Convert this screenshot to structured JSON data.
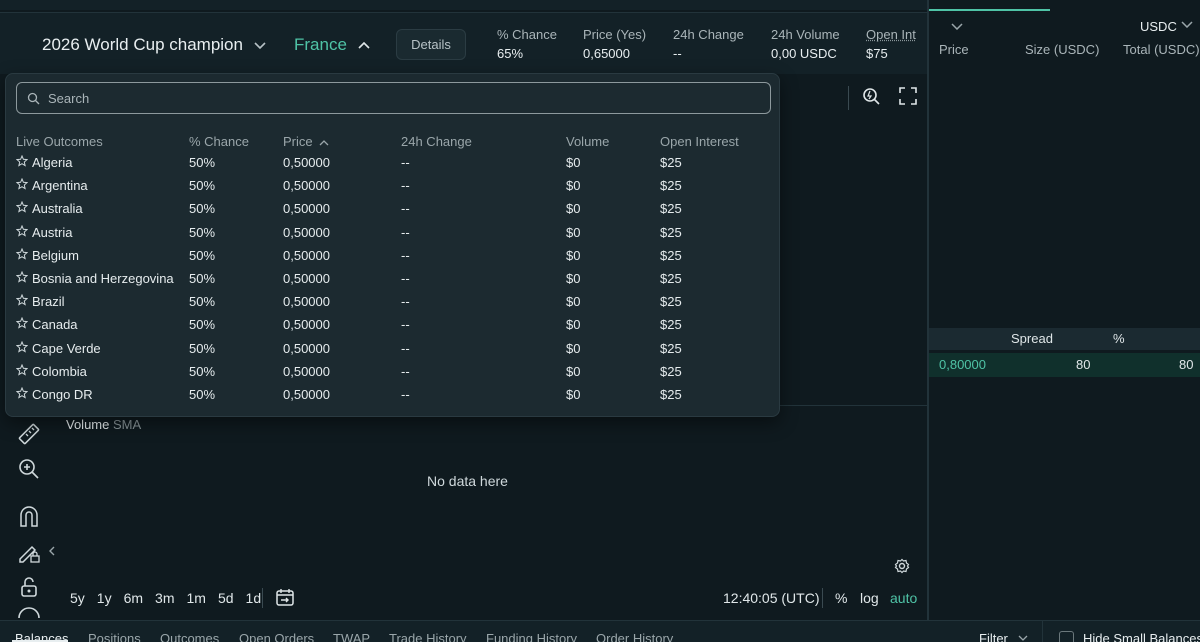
{
  "header": {
    "market_title": "2026 World Cup champion",
    "selected_outcome": "France",
    "details_label": "Details",
    "stats": [
      {
        "label": "% Chance",
        "value": "65%"
      },
      {
        "label": "Price (Yes)",
        "value": "0,65000"
      },
      {
        "label": "24h Change",
        "value": "--"
      },
      {
        "label": "24h Volume",
        "value": "0,00 USDC"
      },
      {
        "label": "Open Interest",
        "value": "$75"
      }
    ]
  },
  "orderbook": {
    "currency": "USDC",
    "columns": [
      "Price",
      "Size (USDC)",
      "Total (USDC)"
    ],
    "spread_label": "Spread",
    "spread_pct_label": "%",
    "ask_row": {
      "price": "0,80000",
      "size": "80",
      "total": "80"
    }
  },
  "dropdown": {
    "search_placeholder": "Search",
    "columns": [
      "Live Outcomes",
      "% Chance",
      "Price",
      "24h Change",
      "Volume",
      "Open Interest"
    ],
    "rows": [
      {
        "name": "Algeria",
        "chance": "50%",
        "price": "0,50000",
        "change": "--",
        "volume": "$0",
        "oi": "$25"
      },
      {
        "name": "Argentina",
        "chance": "50%",
        "price": "0,50000",
        "change": "--",
        "volume": "$0",
        "oi": "$25"
      },
      {
        "name": "Australia",
        "chance": "50%",
        "price": "0,50000",
        "change": "--",
        "volume": "$0",
        "oi": "$25"
      },
      {
        "name": "Austria",
        "chance": "50%",
        "price": "0,50000",
        "change": "--",
        "volume": "$0",
        "oi": "$25"
      },
      {
        "name": "Belgium",
        "chance": "50%",
        "price": "0,50000",
        "change": "--",
        "volume": "$0",
        "oi": "$25"
      },
      {
        "name": "Bosnia and Herzegovina",
        "chance": "50%",
        "price": "0,50000",
        "change": "--",
        "volume": "$0",
        "oi": "$25"
      },
      {
        "name": "Brazil",
        "chance": "50%",
        "price": "0,50000",
        "change": "--",
        "volume": "$0",
        "oi": "$25"
      },
      {
        "name": "Canada",
        "chance": "50%",
        "price": "0,50000",
        "change": "--",
        "volume": "$0",
        "oi": "$25"
      },
      {
        "name": "Cape Verde",
        "chance": "50%",
        "price": "0,50000",
        "change": "--",
        "volume": "$0",
        "oi": "$25"
      },
      {
        "name": "Colombia",
        "chance": "50%",
        "price": "0,50000",
        "change": "--",
        "volume": "$0",
        "oi": "$25"
      },
      {
        "name": "Congo DR",
        "chance": "50%",
        "price": "0,50000",
        "change": "--",
        "volume": "$0",
        "oi": "$25"
      }
    ]
  },
  "chart": {
    "volume_label": "Volume",
    "volume_indicator": "SMA",
    "empty_text": "No data here",
    "timeframes": [
      "5y",
      "1y",
      "6m",
      "3m",
      "1m",
      "5d",
      "1d"
    ],
    "clock": "12:40:05 (UTC)",
    "percent_label": "%",
    "log_label": "log",
    "auto_label": "auto"
  },
  "bottom_tabs": [
    "Balances",
    "Positions",
    "Outcomes",
    "Open Orders",
    "TWAP",
    "Trade History",
    "Funding History",
    "Order History"
  ],
  "bottom_right": {
    "filter_label": "Filter",
    "hide_small_label": "Hide Small Balances"
  },
  "colors": {
    "accent": "#4fc3a6",
    "background": "#0f1a1f",
    "panel": "#132127",
    "dropdown": "#1c2a30"
  }
}
